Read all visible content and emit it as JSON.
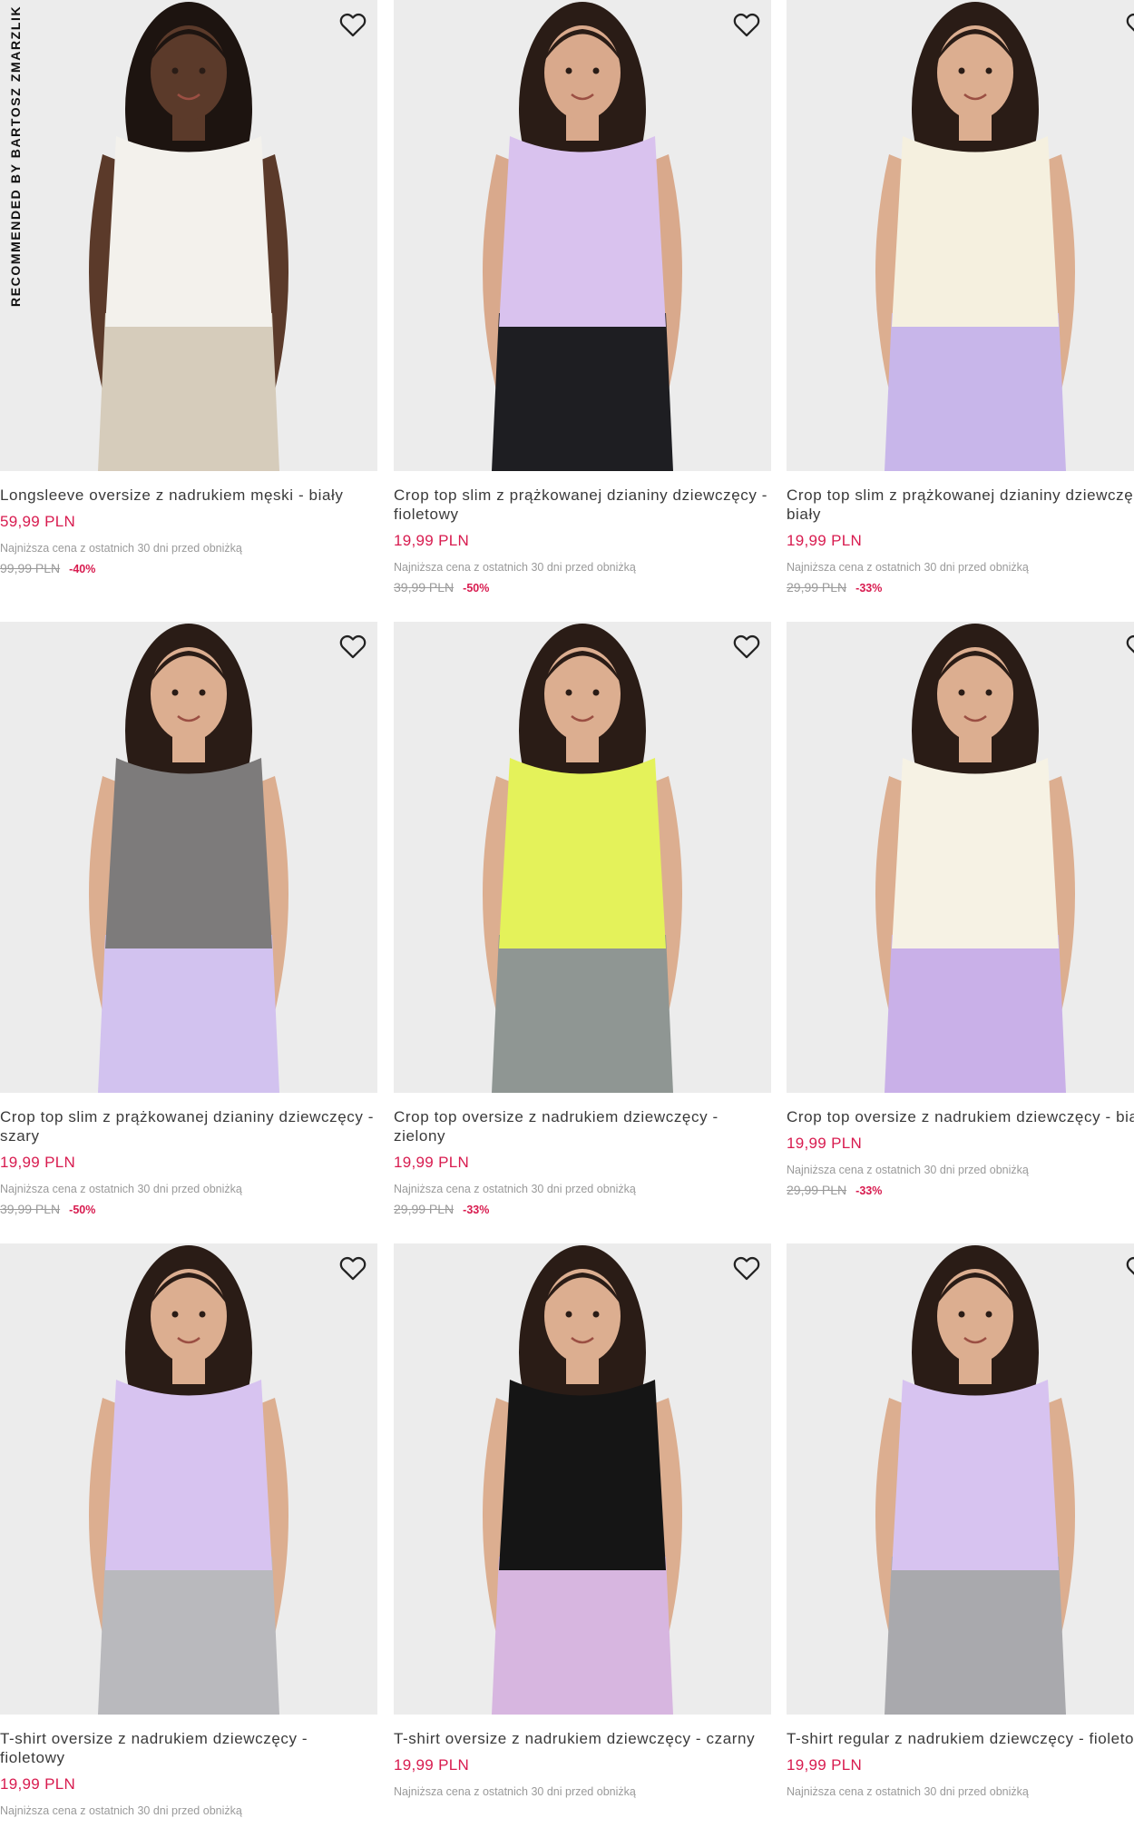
{
  "recommendation_label": "RECOMMENDED BY BARTOSZ ZMARZLIK",
  "lowest_price_note": "Najniższa cena z ostatnich 30 dni przed obniżką",
  "colors": {
    "price": "#d81b4f",
    "photo_bg": "#ececec"
  },
  "products": [
    {
      "name": "Longsleeve oversize z nadrukiem męski - biały",
      "price": "59,99 PLN",
      "old_price": "99,99 PLN",
      "discount": "-40%",
      "favorite_icon": "heart-outline-icon",
      "shirt_color": "#f3f1ec",
      "shorts_color": "#d6ccbb",
      "skin_color": "#5b3a2a",
      "hair_color": "#1d1410"
    },
    {
      "name": "Crop top slim z prążkowanej dzianiny dziewczęcy - fioletowy",
      "price": "19,99 PLN",
      "old_price": "39,99 PLN",
      "discount": "-50%",
      "favorite_icon": "heart-outline-icon",
      "shirt_color": "#d9c2ee",
      "shorts_color": "#1e1e22",
      "skin_color": "#d9a98c",
      "hair_color": "#2a1c16"
    },
    {
      "name": "Crop top slim z prążkowanej dzianiny dziewczęcy - biały",
      "price": "19,99 PLN",
      "old_price": "29,99 PLN",
      "discount": "-33%",
      "favorite_icon": "heart-outline-icon",
      "shirt_color": "#f5f0df",
      "shorts_color": "#c8b6ea",
      "skin_color": "#dcae90",
      "hair_color": "#2a1c16"
    },
    {
      "name": "Crop top slim z prążkowanej dzianiny dziewczęcy - szary",
      "price": "19,99 PLN",
      "old_price": "39,99 PLN",
      "discount": "-50%",
      "favorite_icon": "heart-outline-icon",
      "shirt_color": "#7d7b7b",
      "shorts_color": "#d2c2ef",
      "skin_color": "#dcae90",
      "hair_color": "#2a1c16"
    },
    {
      "name": "Crop top oversize z nadrukiem dziewczęcy - zielony",
      "price": "19,99 PLN",
      "old_price": "29,99 PLN",
      "discount": "-33%",
      "favorite_icon": "heart-outline-icon",
      "shirt_color": "#e4f25a",
      "shorts_color": "#8f9693",
      "skin_color": "#dcae90",
      "hair_color": "#2a1c16"
    },
    {
      "name": "Crop top oversize z nadrukiem dziewczęcy - biały",
      "price": "19,99 PLN",
      "old_price": "29,99 PLN",
      "discount": "-33%",
      "favorite_icon": "heart-outline-icon",
      "shirt_color": "#f6f2e4",
      "shorts_color": "#c9b0e8",
      "skin_color": "#dcae90",
      "hair_color": "#2a1c16"
    },
    {
      "name": "T-shirt oversize z nadrukiem dziewczęcy - fioletowy",
      "price": "19,99 PLN",
      "old_price": "",
      "discount": "",
      "favorite_icon": "heart-outline-icon",
      "shirt_color": "#d7c3f0",
      "shorts_color": "#b9b9bd",
      "skin_color": "#dcae90",
      "hair_color": "#2a1c16"
    },
    {
      "name": "T-shirt oversize z nadrukiem dziewczęcy - czarny",
      "price": "19,99 PLN",
      "old_price": "",
      "discount": "",
      "favorite_icon": "heart-outline-icon",
      "shirt_color": "#151515",
      "shorts_color": "#d7b6e0",
      "skin_color": "#dcae90",
      "hair_color": "#2a1c16"
    },
    {
      "name": "T-shirt regular z nadrukiem dziewczęcy - fioletowy",
      "price": "19,99 PLN",
      "old_price": "",
      "discount": "",
      "favorite_icon": "heart-outline-icon",
      "shirt_color": "#d7c3f0",
      "shorts_color": "#a9a9ad",
      "skin_color": "#dcae90",
      "hair_color": "#2a1c16"
    }
  ]
}
